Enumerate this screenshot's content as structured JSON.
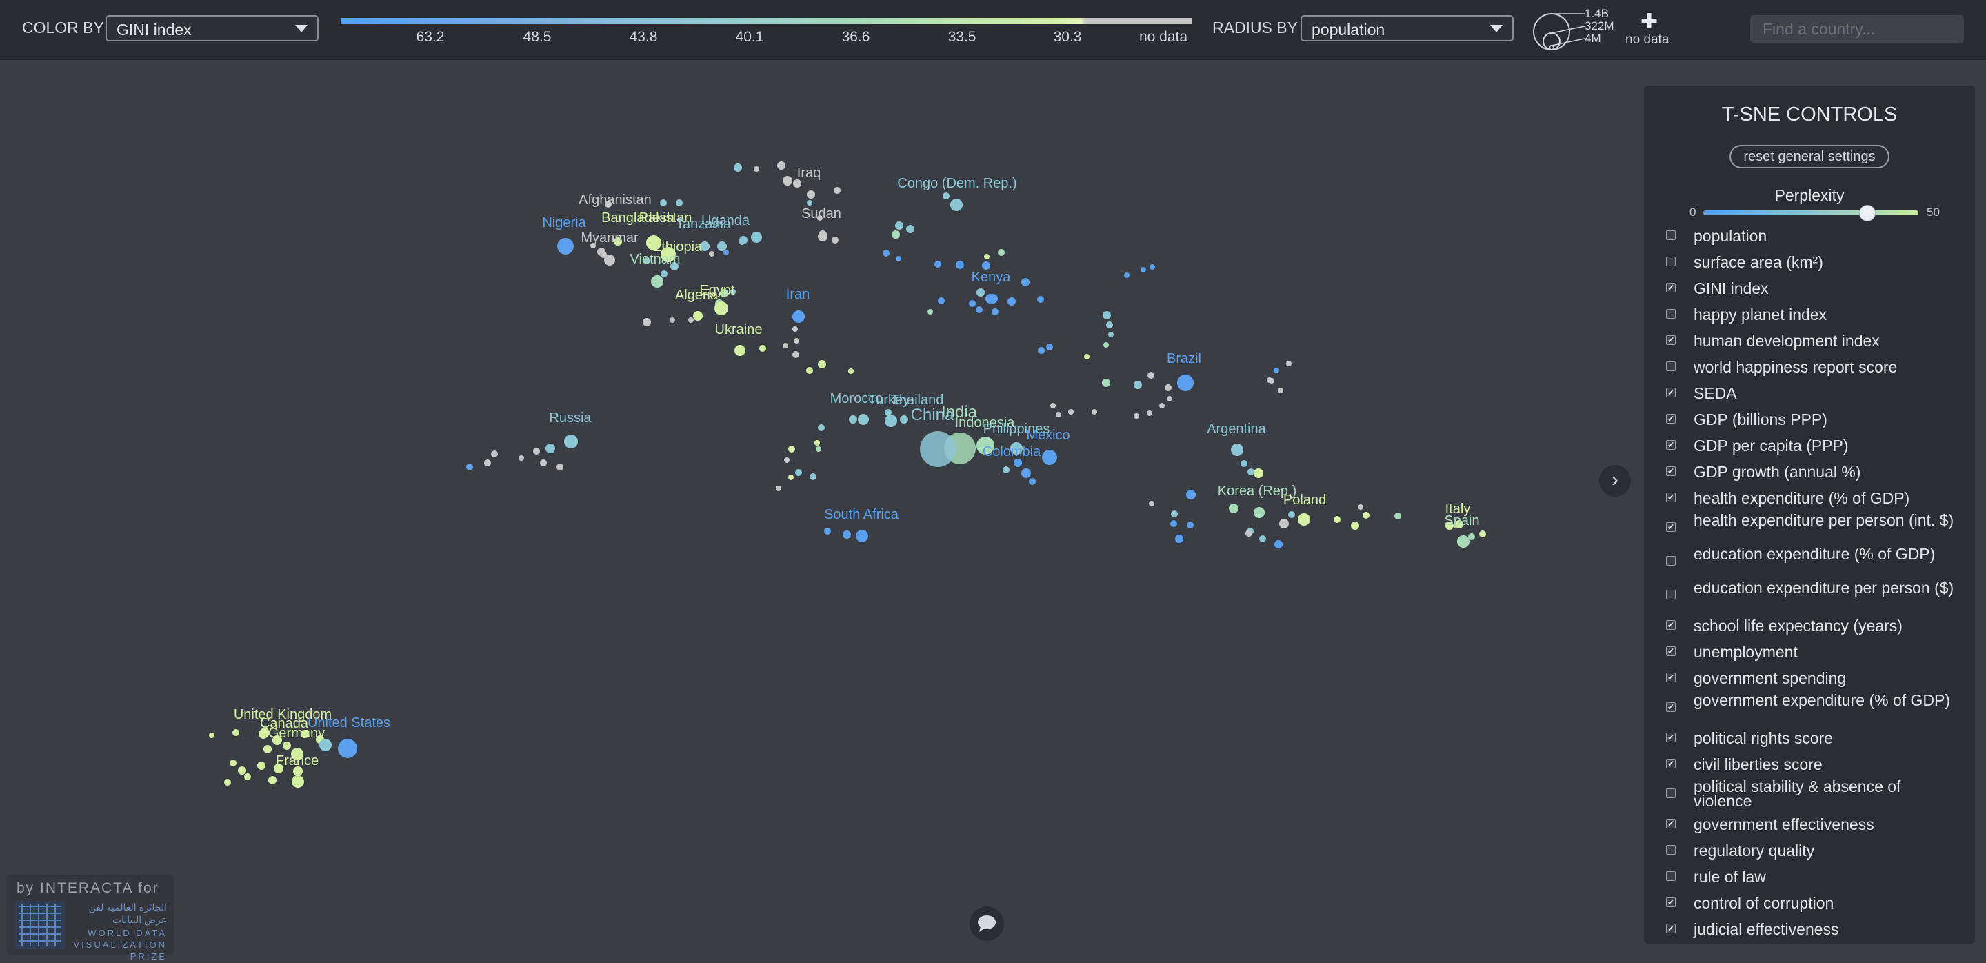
{
  "toolbar": {
    "color_by_label": "COLOR BY",
    "color_by_value": "GINI index",
    "radius_by_label": "RADIUS BY",
    "radius_by_value": "population",
    "legend_ticks": [
      "63.2",
      "48.5",
      "43.8",
      "40.1",
      "36.6",
      "33.5",
      "30.3",
      "no data"
    ],
    "radius_values": [
      "1.4B",
      "322M",
      "4M"
    ],
    "radius_no_data": "no data",
    "search_placeholder": "Find a country..."
  },
  "colors": {
    "background": "#3a3d44",
    "bar": "#2a2c31",
    "panel": "#2b2d32",
    "blue": "#5aa0ef",
    "teal": "#8cc6d4",
    "green": "#a8dcb9",
    "lime": "#d3f0a3",
    "gray": "#c7c7c7"
  },
  "panel": {
    "title": "T-SNE CONTROLS",
    "reset_label": "reset general settings",
    "perplexity_label": "Perplexity",
    "slider_min": "0",
    "slider_max": "50",
    "perplexity_value": 38,
    "options": [
      {
        "label": "population",
        "checked": false
      },
      {
        "label": "surface area (km²)",
        "checked": false
      },
      {
        "label": "GINI index",
        "checked": true
      },
      {
        "label": "happy planet index",
        "checked": false
      },
      {
        "label": "human development index",
        "checked": true
      },
      {
        "label": "world happiness report score",
        "checked": false
      },
      {
        "label": "SEDA",
        "checked": true
      },
      {
        "label": "GDP (billions PPP)",
        "checked": true
      },
      {
        "label": "GDP per capita (PPP)",
        "checked": true
      },
      {
        "label": "GDP growth (annual %)",
        "checked": true
      },
      {
        "label": "health expenditure (% of GDP)",
        "checked": true
      },
      {
        "label": "health expenditure per person (int. $)",
        "checked": true
      },
      {
        "label": "education expenditure (% of GDP)",
        "checked": false
      },
      {
        "label": "education expenditure per person ($)",
        "checked": false
      },
      {
        "label": "school life expectancy (years)",
        "checked": true
      },
      {
        "label": "unemployment",
        "checked": true
      },
      {
        "label": "government spending",
        "checked": true
      },
      {
        "label": "government expenditure (% of GDP)",
        "checked": true
      },
      {
        "label": "political rights score",
        "checked": true
      },
      {
        "label": "civil liberties score",
        "checked": true
      },
      {
        "label": "political stability & absence of violence",
        "checked": false
      },
      {
        "label": "government effectiveness",
        "checked": true
      },
      {
        "label": "regulatory quality",
        "checked": false
      },
      {
        "label": "rule of law",
        "checked": false
      },
      {
        "label": "control of corruption",
        "checked": true
      },
      {
        "label": "judicial effectiveness",
        "checked": true
      }
    ]
  },
  "countries": [
    {
      "name": "Afghanistan",
      "color": "gray"
    },
    {
      "name": "Iraq",
      "color": "gray"
    },
    {
      "name": "Congo (Dem. Rep.)",
      "color": "teal"
    },
    {
      "name": "Nigeria",
      "color": "blue"
    },
    {
      "name": "Bangladesh",
      "color": "lime"
    },
    {
      "name": "Pakistan",
      "color": "lime"
    },
    {
      "name": "Uganda",
      "color": "teal"
    },
    {
      "name": "Tanzania",
      "color": "teal"
    },
    {
      "name": "Sudan",
      "color": "gray"
    },
    {
      "name": "Myanmar",
      "color": "gray"
    },
    {
      "name": "Ethiopia",
      "color": "lime"
    },
    {
      "name": "Vietnam",
      "color": "green"
    },
    {
      "name": "Egypt",
      "color": "lime"
    },
    {
      "name": "Algeria",
      "color": "lime"
    },
    {
      "name": "Iran",
      "color": "blue"
    },
    {
      "name": "Kenya",
      "color": "blue"
    },
    {
      "name": "Ukraine",
      "color": "lime"
    },
    {
      "name": "Brazil",
      "color": "blue"
    },
    {
      "name": "Russia",
      "color": "teal"
    },
    {
      "name": "Morocco",
      "color": "teal"
    },
    {
      "name": "Turkey",
      "color": "teal"
    },
    {
      "name": "Thailand",
      "color": "teal"
    },
    {
      "name": "India",
      "color": "green"
    },
    {
      "name": "China",
      "color": "teal"
    },
    {
      "name": "Indonesia",
      "color": "green"
    },
    {
      "name": "Philippines",
      "color": "teal"
    },
    {
      "name": "Mexico",
      "color": "blue"
    },
    {
      "name": "Colombia",
      "color": "blue"
    },
    {
      "name": "Argentina",
      "color": "teal"
    },
    {
      "name": "Korea (Rep.)",
      "color": "green"
    },
    {
      "name": "Poland",
      "color": "lime"
    },
    {
      "name": "Italy",
      "color": "lime"
    },
    {
      "name": "Spain",
      "color": "green"
    },
    {
      "name": "South Africa",
      "color": "blue"
    },
    {
      "name": "United Kingdom",
      "color": "lime"
    },
    {
      "name": "Canada",
      "color": "lime"
    },
    {
      "name": "United States",
      "color": "blue"
    },
    {
      "name": "Germany",
      "color": "lime"
    },
    {
      "name": "France",
      "color": "lime"
    }
  ],
  "logo": {
    "by_text": "by INTERACTA for",
    "arabic_text": "الجائزة العالمية لفن عرض البيانات",
    "english_text": "WORLD DATA VISUALIZATION PRIZE"
  }
}
